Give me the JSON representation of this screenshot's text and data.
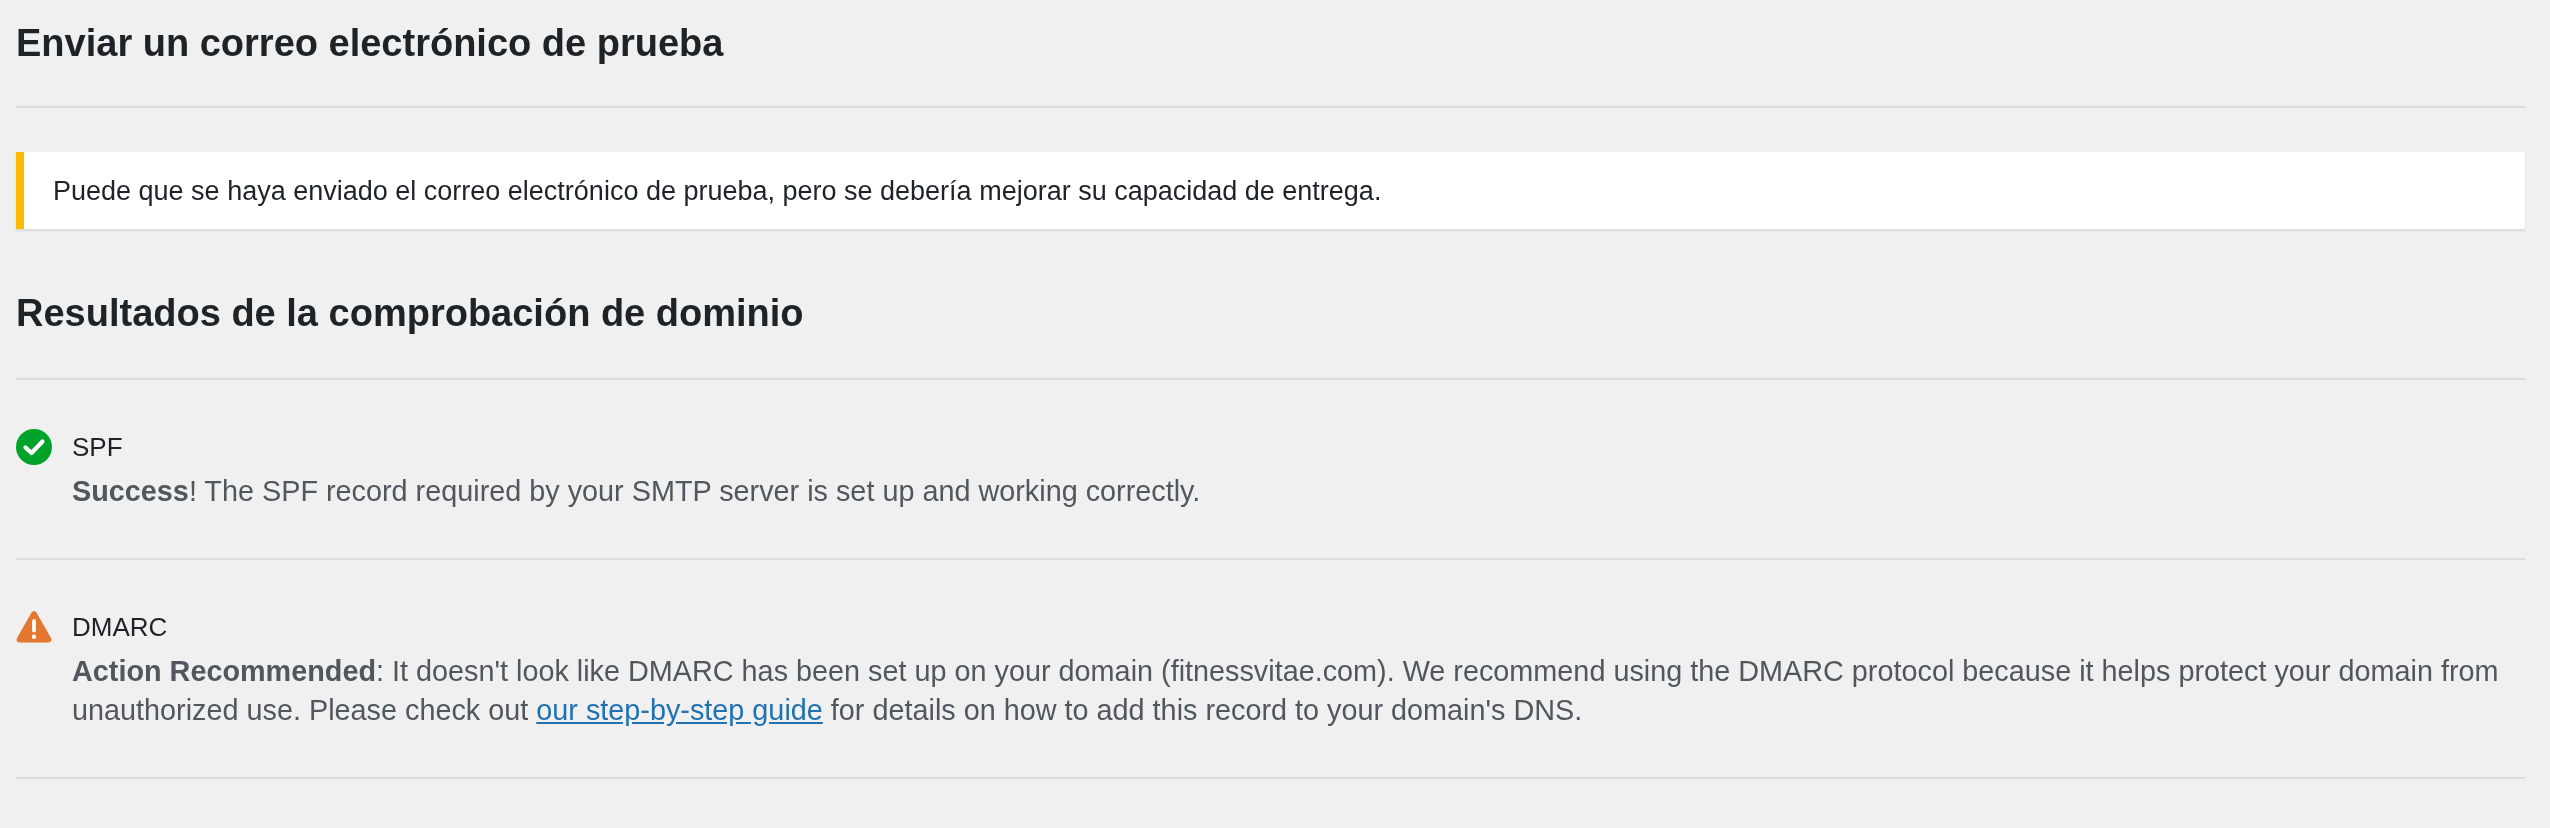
{
  "test_email": {
    "heading": "Enviar un correo electrónico de prueba",
    "notice": {
      "kind": "warning",
      "text": "Puede que se haya enviado el correo electrónico de prueba, pero se debería mejorar su capacidad de entrega."
    }
  },
  "domain_check": {
    "heading": "Resultados de la comprobación de dominio",
    "results": [
      {
        "kind": "success",
        "name": "SPF",
        "description": "**Success**! The SPF record required by your SMTP server is set up and working correctly."
      },
      {
        "kind": "warning",
        "name": "DMARC",
        "description": "**Action Recommended**: It doesn't look like DMARC has been set up on your domain (fitnessvitae.com). We recommend using the DMARC protocol because it helps protect your domain from unauthorized use. Please check out",
        "link": "our step-by-step guide",
        "description_end": "for details on how to add this record to your domain's DNS."
      }
    ]
  }
}
